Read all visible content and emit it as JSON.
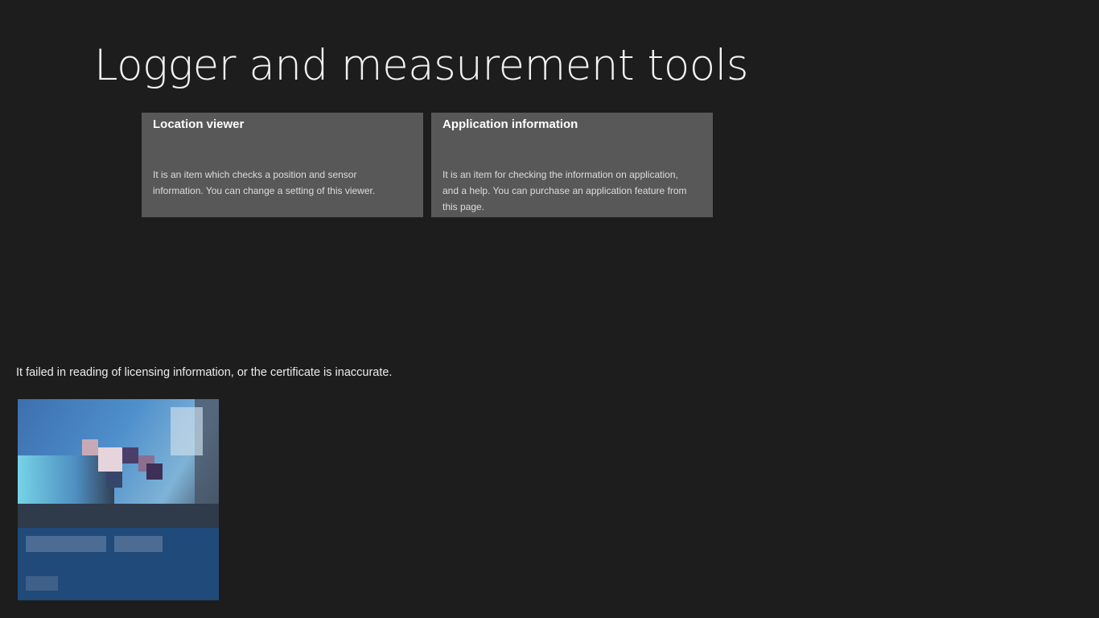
{
  "page": {
    "title": "Logger and measurement tools"
  },
  "tiles": [
    {
      "title": "Location viewer",
      "description": "It is an item which checks a position and sensor information. You can change a setting of this viewer."
    },
    {
      "title": "Application information",
      "description": "It is an item for checking the information on application, and a help. You can purchase an application feature from this page."
    }
  ],
  "license": {
    "message": "It failed in reading of licensing information, or the certificate is inaccurate."
  },
  "promo": {
    "icon": "pixelated-ad-image"
  },
  "colors": {
    "background": "#1d1d1d",
    "tile": "#585858",
    "promo_panel": "#1f4a7a"
  }
}
